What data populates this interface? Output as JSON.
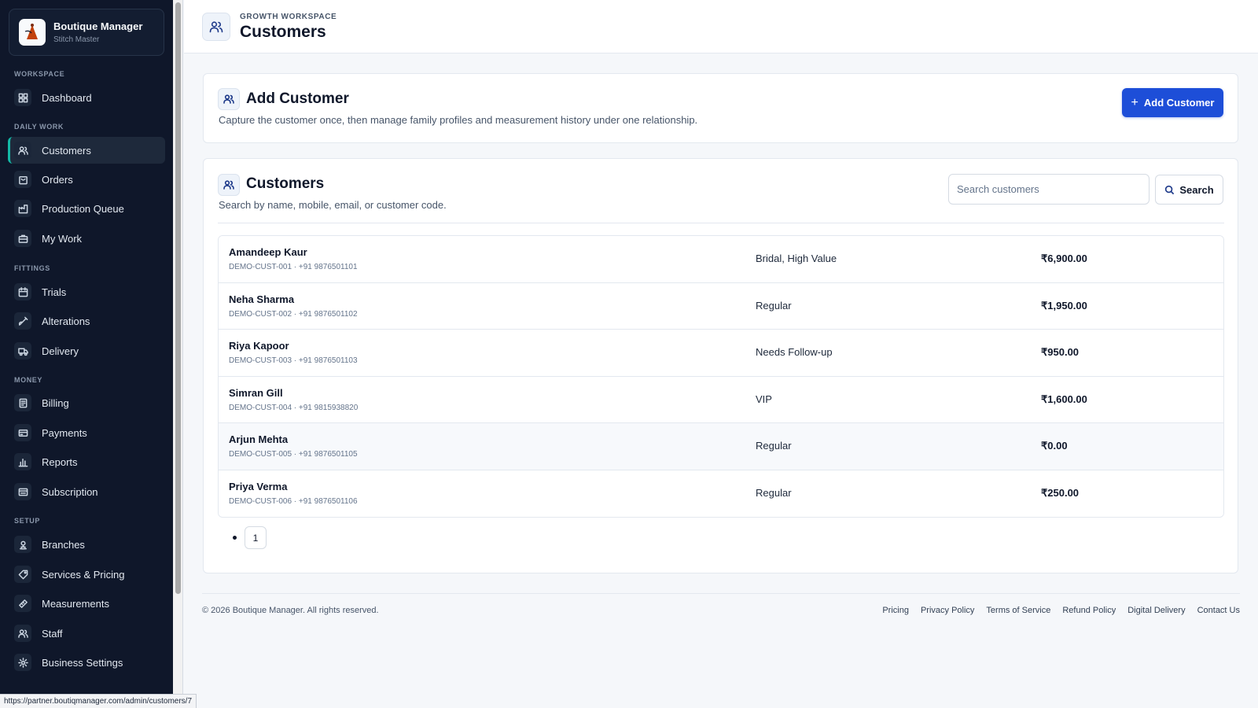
{
  "brand": {
    "name": "Boutique Manager",
    "subtitle": "Stitch Master"
  },
  "sidebar": {
    "sections": [
      "WORKSPACE",
      "DAILY WORK",
      "FITTINGS",
      "MONEY",
      "SETUP"
    ],
    "items": [
      {
        "label": "Dashboard",
        "icon": "dashboard-icon"
      },
      {
        "label": "Customers",
        "icon": "users-icon",
        "active": true
      },
      {
        "label": "Orders",
        "icon": "bag-icon"
      },
      {
        "label": "Production Queue",
        "icon": "factory-icon"
      },
      {
        "label": "My Work",
        "icon": "briefcase-icon"
      },
      {
        "label": "Trials",
        "icon": "calendar-icon"
      },
      {
        "label": "Alterations",
        "icon": "needle-icon"
      },
      {
        "label": "Delivery",
        "icon": "truck-icon"
      },
      {
        "label": "Billing",
        "icon": "receipt-icon"
      },
      {
        "label": "Payments",
        "icon": "card-icon"
      },
      {
        "label": "Reports",
        "icon": "bar-chart-icon"
      },
      {
        "label": "Subscription",
        "icon": "subscription-icon"
      },
      {
        "label": "Branches",
        "icon": "branch-icon"
      },
      {
        "label": "Services & Pricing",
        "icon": "tag-icon"
      },
      {
        "label": "Measurements",
        "icon": "ruler-icon"
      },
      {
        "label": "Staff",
        "icon": "staff-icon"
      },
      {
        "label": "Business Settings",
        "icon": "gear-icon"
      }
    ]
  },
  "header": {
    "eyebrow": "GROWTH WORKSPACE",
    "title": "Customers"
  },
  "add_card": {
    "title": "Add Customer",
    "description": "Capture the customer once, then manage family profiles and measurement history under one relationship.",
    "button_label": "Add Customer"
  },
  "list_card": {
    "title": "Customers",
    "description": "Search by name, mobile, email, or customer code.",
    "search_placeholder": "Search customers",
    "search_button": "Search"
  },
  "customers": [
    {
      "name": "Amandeep Kaur",
      "meta": "DEMO-CUST-001 · +91 9876501101",
      "tags": "Bridal, High Value",
      "amount": "₹6,900.00"
    },
    {
      "name": "Neha Sharma",
      "meta": "DEMO-CUST-002 · +91 9876501102",
      "tags": "Regular",
      "amount": "₹1,950.00"
    },
    {
      "name": "Riya Kapoor",
      "meta": "DEMO-CUST-003 · +91 9876501103",
      "tags": "Needs Follow-up",
      "amount": "₹950.00"
    },
    {
      "name": "Simran Gill",
      "meta": "DEMO-CUST-004 · +91 9815938820",
      "tags": "VIP",
      "amount": "₹1,600.00"
    },
    {
      "name": "Arjun Mehta",
      "meta": "DEMO-CUST-005 · +91 9876501105",
      "tags": "Regular",
      "amount": "₹0.00"
    },
    {
      "name": "Priya Verma",
      "meta": "DEMO-CUST-006 · +91 9876501106",
      "tags": "Regular",
      "amount": "₹250.00"
    }
  ],
  "pagination": {
    "current": "1"
  },
  "footer": {
    "copyright": "© 2026 Boutique Manager. All rights reserved.",
    "links": [
      "Pricing",
      "Privacy Policy",
      "Terms of Service",
      "Refund Policy",
      "Digital Delivery",
      "Contact Us"
    ]
  },
  "status_url": "https://partner.boutiqmanager.com/admin/customers/7",
  "colors": {
    "sidebar_bg": "#0f172a",
    "accent": "#1d4ed8",
    "active_marker": "#14b8a6"
  }
}
